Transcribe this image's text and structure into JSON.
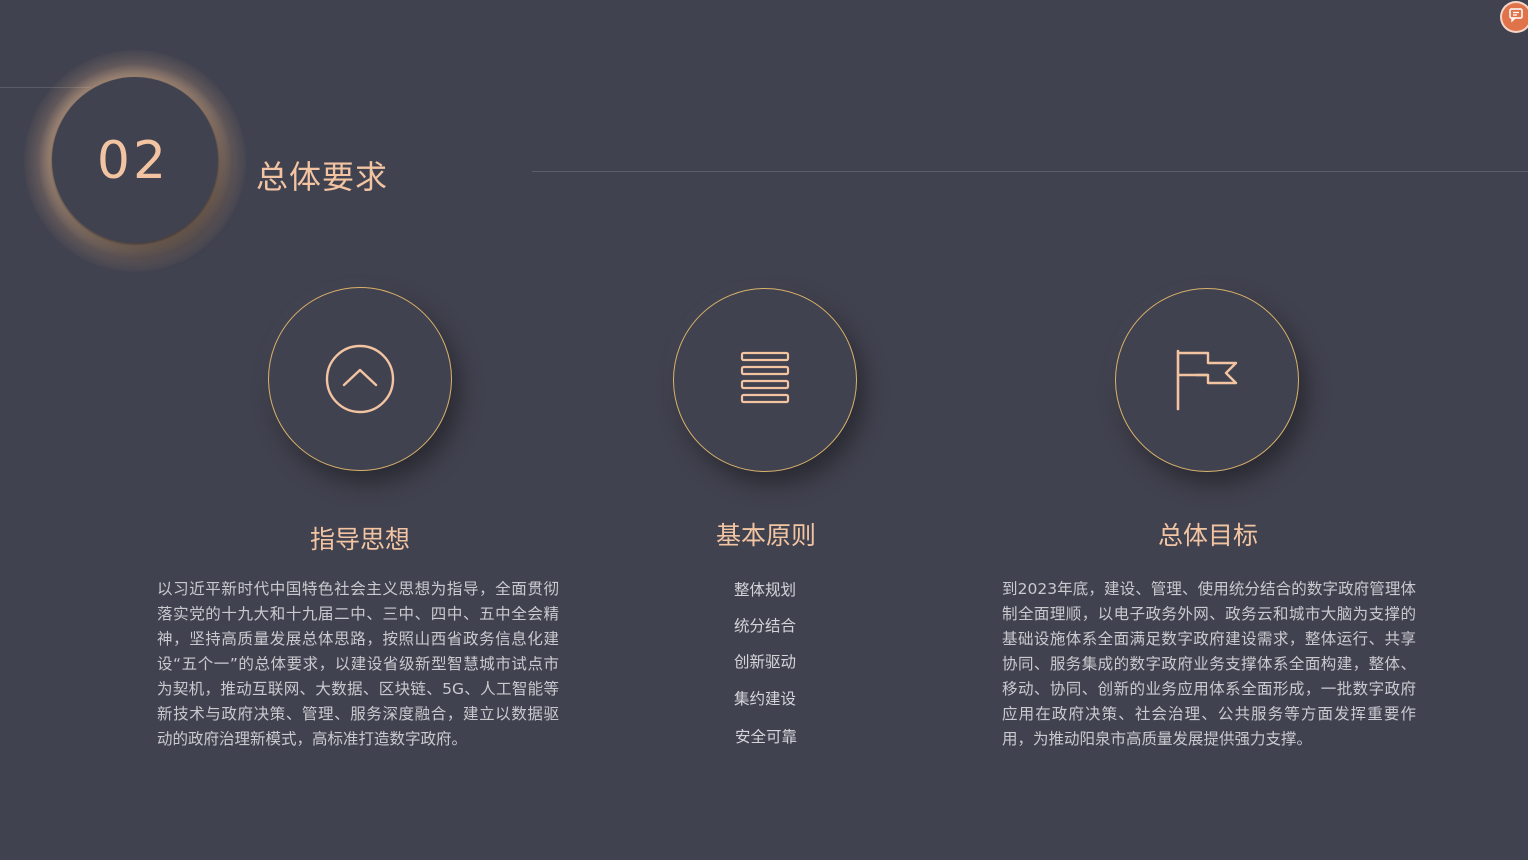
{
  "header": {
    "number": "02",
    "title": "总体要求"
  },
  "sections": [
    {
      "title": "指导思想",
      "icon": "chevron-up-icon",
      "body": "以习近平新时代中国特色社会主义思想为指导，全面贯彻落实党的十九大和十九届二中、三中、四中、五中全会精神，坚持高质量发展总体思路，按照山西省政务信息化建设“五个一”的总体要求，以建设省级新型智慧城市试点市为契机，推动互联网、大数据、区块链、5G、人工智能等新技术与政府决策、管理、服务深度融合，建立以数据驱动的政府治理新模式，高标准打造数字政府。"
    },
    {
      "title": "基本原则",
      "icon": "list-icon",
      "items": [
        "整体规划",
        "统分结合",
        "创新驱动",
        "集约建设",
        "安全可靠"
      ]
    },
    {
      "title": "总体目标",
      "icon": "flag-icon",
      "body": "到2023年底，建设、管理、使用统分结合的数字政府管理体制全面理顺，以电子政务外网、政务云和城市大脑为支撑的基础设施体系全面满足数字政府建设需求，整体运行、共享协同、服务集成的数字政府业务支撑体系全面构建，整体、移动、协同、创新的业务应用体系全面形成，一批数字政府应用在政府决策、社会治理、公共服务等方面发挥重要作用，为推动阳泉市高质量发展提供强力支撑。"
    }
  ],
  "corner_badge": {
    "icon": "chat-icon"
  },
  "colors": {
    "background": "#41424f",
    "accent": "#f2c4a2",
    "ring": "#d9b16a",
    "body_text": "#c9c9cf"
  }
}
